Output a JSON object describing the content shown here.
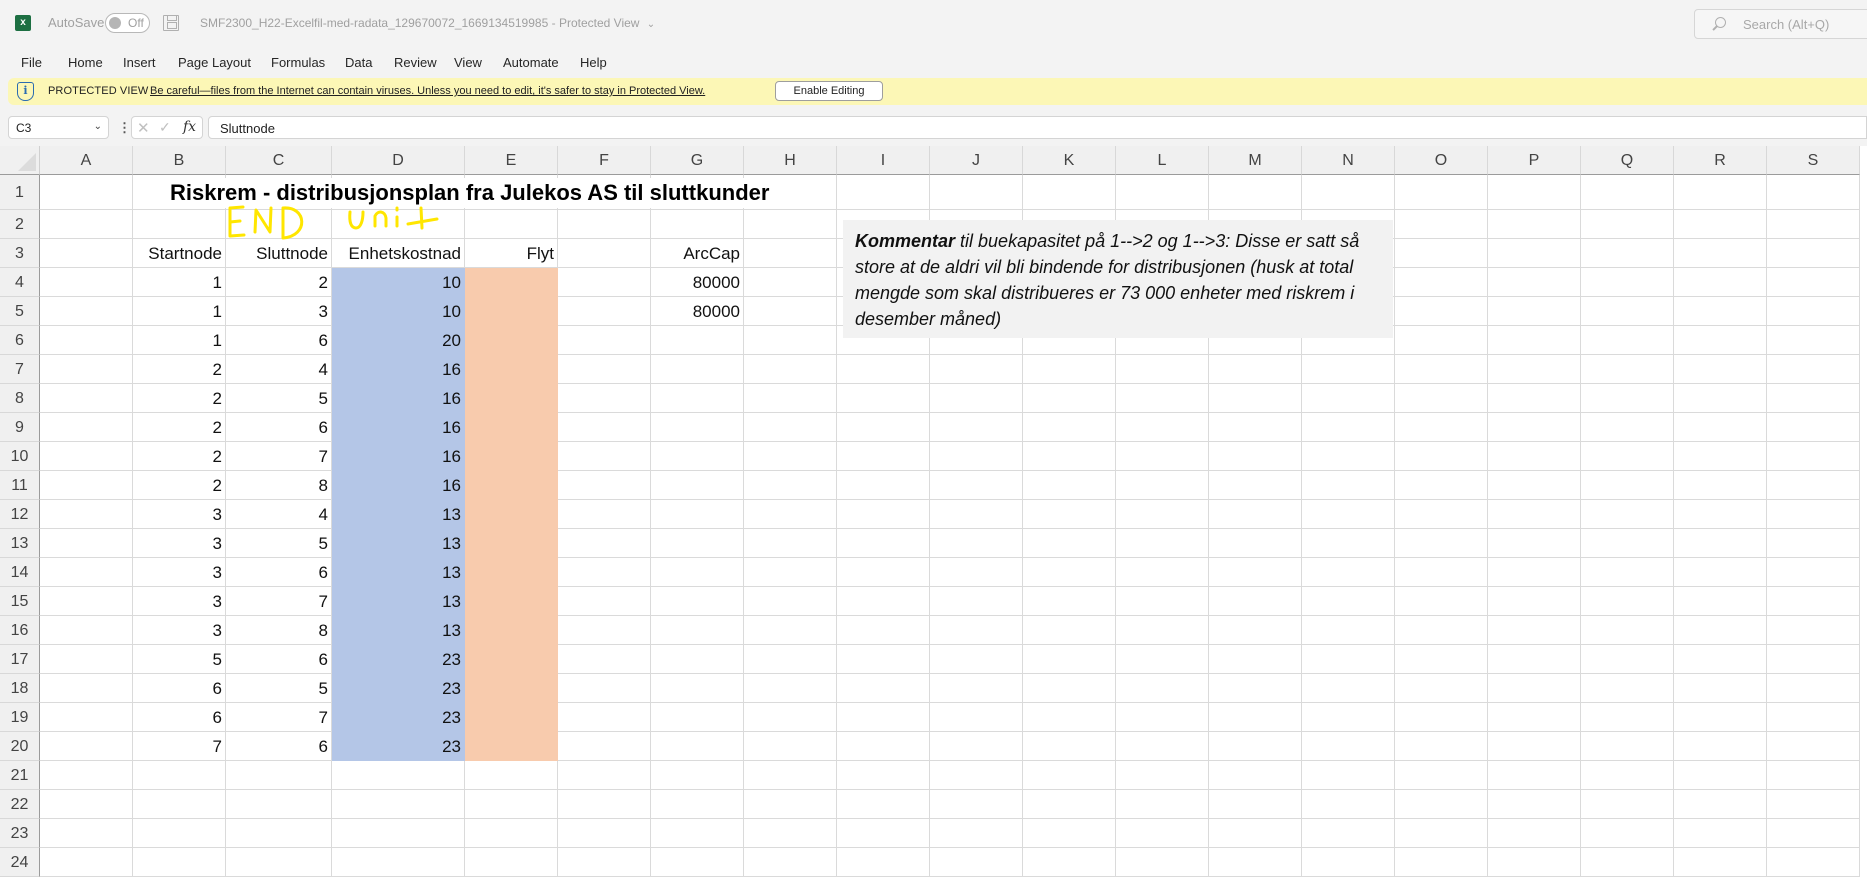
{
  "titlebar": {
    "app_icon": "excel-icon",
    "autosave_label": "AutoSave",
    "autosave_state": "Off",
    "document_title": "SMF2300_H22-Excelfil-med-radata_129670072_1669134519985",
    "mode": "Protected View",
    "search_placeholder": "Search (Alt+Q)"
  },
  "menu": [
    "File",
    "Home",
    "Insert",
    "Page Layout",
    "Formulas",
    "Data",
    "Review",
    "View",
    "Automate",
    "Help"
  ],
  "protected_view": {
    "title": "PROTECTED VIEW",
    "message": "Be careful—files from the Internet can contain viruses. Unless you need to edit, it's safer to stay in Protected View.",
    "button": "Enable Editing"
  },
  "formula_bar": {
    "name_box": "C3",
    "formula": "Sluttnode"
  },
  "columns": [
    "A",
    "B",
    "C",
    "D",
    "E",
    "F",
    "G",
    "H",
    "I",
    "J",
    "K",
    "L",
    "M",
    "N",
    "O",
    "P",
    "Q",
    "R",
    "S"
  ],
  "rows": [
    "1",
    "2",
    "3",
    "4",
    "5",
    "6",
    "7",
    "8",
    "9",
    "10",
    "11",
    "12",
    "13",
    "14",
    "15",
    "16",
    "17",
    "18",
    "19",
    "20",
    "21",
    "22",
    "23",
    "24"
  ],
  "sheet": {
    "title": "Riskrem - distribusjonsplan fra Julekos AS til sluttkunder",
    "handwritten_annotation": "END unit",
    "headers": {
      "startnode": "Startnode",
      "sluttnode": "Sluttnode",
      "enhetskostnad": "Enhetskostnad",
      "flyt": "Flyt",
      "arccap": "ArcCap"
    },
    "arcs": [
      {
        "start": "1",
        "end": "2",
        "cost": "10",
        "flow": ""
      },
      {
        "start": "1",
        "end": "3",
        "cost": "10",
        "flow": ""
      },
      {
        "start": "1",
        "end": "6",
        "cost": "20",
        "flow": ""
      },
      {
        "start": "2",
        "end": "4",
        "cost": "16",
        "flow": ""
      },
      {
        "start": "2",
        "end": "5",
        "cost": "16",
        "flow": ""
      },
      {
        "start": "2",
        "end": "6",
        "cost": "16",
        "flow": ""
      },
      {
        "start": "2",
        "end": "7",
        "cost": "16",
        "flow": ""
      },
      {
        "start": "2",
        "end": "8",
        "cost": "16",
        "flow": ""
      },
      {
        "start": "3",
        "end": "4",
        "cost": "13",
        "flow": ""
      },
      {
        "start": "3",
        "end": "5",
        "cost": "13",
        "flow": ""
      },
      {
        "start": "3",
        "end": "6",
        "cost": "13",
        "flow": ""
      },
      {
        "start": "3",
        "end": "7",
        "cost": "13",
        "flow": ""
      },
      {
        "start": "3",
        "end": "8",
        "cost": "13",
        "flow": ""
      },
      {
        "start": "5",
        "end": "6",
        "cost": "23",
        "flow": ""
      },
      {
        "start": "6",
        "end": "5",
        "cost": "23",
        "flow": ""
      },
      {
        "start": "6",
        "end": "7",
        "cost": "23",
        "flow": ""
      },
      {
        "start": "7",
        "end": "6",
        "cost": "23",
        "flow": ""
      }
    ],
    "arccap": [
      "80000",
      "80000"
    ],
    "comment": {
      "bold": "Kommentar",
      "text": " til buekapasitet på 1-->2 og 1-->3: Disse er satt så store at de aldri vil bli bindende for distribusjonen (husk at total mengde som skal distribueres er 73 000 enheter med riskrem i desember måned)"
    }
  },
  "colors": {
    "cost_fill": "#b4c6e7",
    "flow_fill": "#f8cbad",
    "protected_bar": "#fcf7b6",
    "annotation_ink": "#ffe600",
    "excel_green": "#1d6f42"
  }
}
